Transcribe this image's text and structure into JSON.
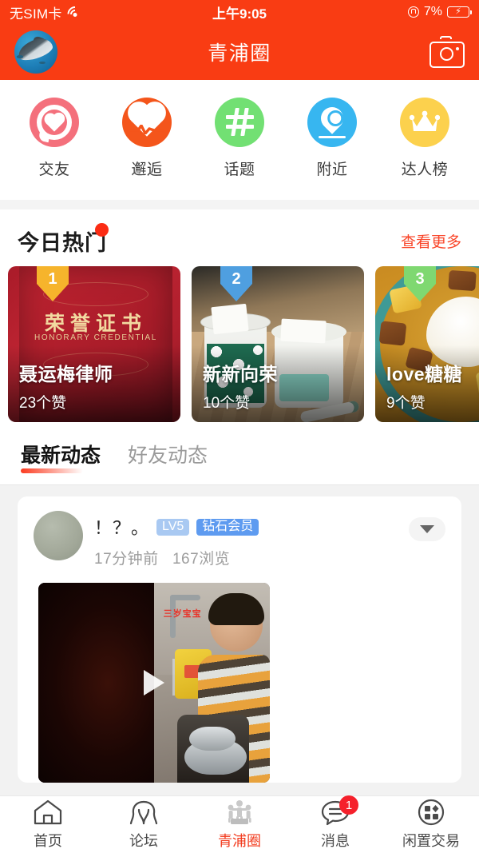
{
  "status_bar": {
    "carrier": "无SIM卡",
    "wifi_icon": "wifi-icon",
    "time": "上午9:05",
    "lock_icon": "rotation-lock-icon",
    "battery_percent": "7%",
    "battery_icon": "battery-charging-icon"
  },
  "app_bar": {
    "avatar_icon": "user-avatar-dolphin",
    "title": "青浦圈",
    "camera_icon": "camera-icon"
  },
  "shortcuts": [
    {
      "label": "交友",
      "icon": "heart-chat-icon",
      "color": "#f4707c"
    },
    {
      "label": "邂逅",
      "icon": "heartbeat-icon",
      "color": "#f4551b"
    },
    {
      "label": "话题",
      "icon": "hashtag-bubble-icon",
      "color": "#72e073"
    },
    {
      "label": "附近",
      "icon": "location-pin-icon",
      "color": "#37b6f0"
    },
    {
      "label": "达人榜",
      "icon": "crown-icon",
      "color": "#fcd14d"
    }
  ],
  "hot_section": {
    "title": "今日热门",
    "more_label": "查看更多",
    "more_color": "#f9462a",
    "cards": [
      {
        "rank": "1",
        "rank_color": "#f6b42c",
        "name": "聂运梅律师",
        "likes": "23个赞",
        "image": "honorary-certificate-photo",
        "cert_title": "荣誉证书",
        "cert_subtitle": "HONORARY CREDENTIAL"
      },
      {
        "rank": "2",
        "rank_color": "#4f9fe0",
        "name": "新新向荣",
        "likes": "10个赞",
        "image": "milk-tea-cups-photo"
      },
      {
        "rank": "3",
        "rank_color": "#7fd871",
        "name": "love糖糖",
        "likes": "9个赞",
        "image": "curry-rice-photo"
      }
    ]
  },
  "feed_tabs": [
    {
      "label": "最新动态",
      "active": true
    },
    {
      "label": "好友动态",
      "active": false
    }
  ],
  "post": {
    "avatar_icon": "post-author-avatar",
    "author": "！？。",
    "level_badge": "LV5",
    "vip_badge": "钻石会员",
    "time_ago": "17分钟前",
    "views": "167浏览",
    "more_icon": "chevron-down-icon",
    "media": {
      "type": "video-thumbnail",
      "description": "child-washing-dishes-at-sink",
      "overlay_text": "三岁宝宝",
      "play_icon": "play-icon"
    }
  },
  "bottom_nav": [
    {
      "label": "首页",
      "icon": "home-icon",
      "active": false,
      "badge": ""
    },
    {
      "label": "论坛",
      "icon": "forum-icon",
      "active": false,
      "badge": ""
    },
    {
      "label": "青浦圈",
      "icon": "circle-people-icon",
      "active": true,
      "badge": ""
    },
    {
      "label": "消息",
      "icon": "message-icon",
      "active": false,
      "badge": "1"
    },
    {
      "label": "闲置交易",
      "icon": "grid-trade-icon",
      "active": false,
      "badge": ""
    }
  ],
  "theme": {
    "primary": "#f93c13",
    "accent_red": "#f23b1e",
    "page_bg": "#f2f2f2"
  }
}
